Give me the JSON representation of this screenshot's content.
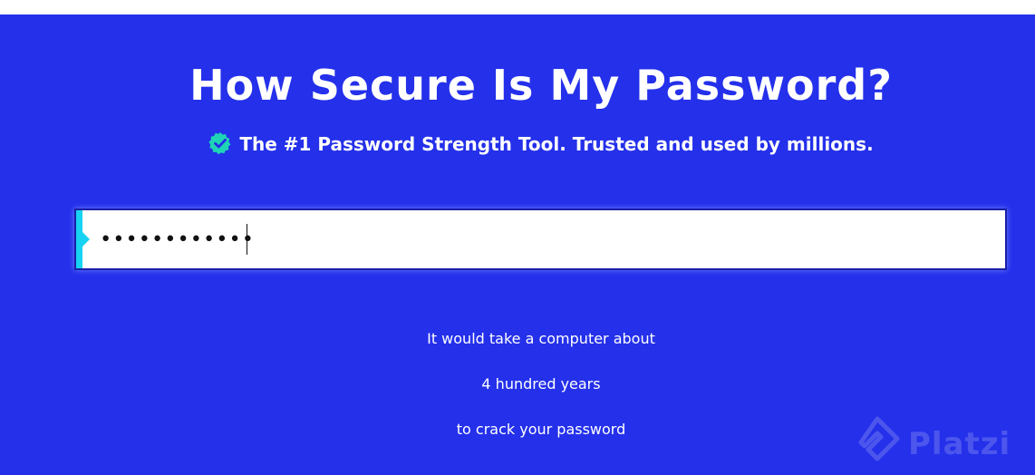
{
  "header": {
    "title": "How Secure Is My Password?",
    "subtitle": "The #1 Password Strength Tool. Trusted and used by millions.",
    "badge_icon": "verified-check-icon"
  },
  "password_field": {
    "value": "••••••••••••",
    "type": "password",
    "accent_color": "#17d3f1"
  },
  "result": {
    "line1": "It would take a computer about",
    "line2": "4 hundred years",
    "line3": "to crack your password"
  },
  "watermark": {
    "text": "Platzi",
    "icon": "platzi-logo-icon"
  },
  "colors": {
    "background": "#2430ea",
    "text": "#ffffff",
    "badge": "#1fd3b5"
  }
}
